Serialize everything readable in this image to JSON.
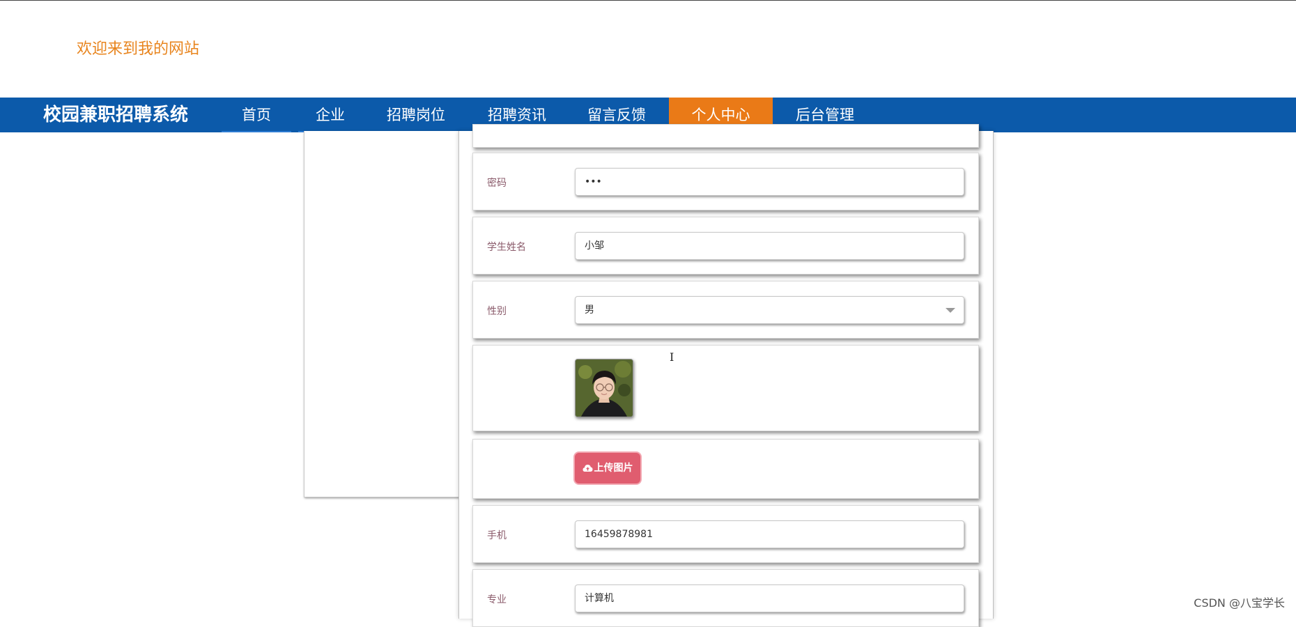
{
  "header": {
    "welcome": "欢迎来到我的网站"
  },
  "nav": {
    "brand": "校园兼职招聘系统",
    "items": [
      {
        "label": "首页"
      },
      {
        "label": "企业"
      },
      {
        "label": "招聘岗位"
      },
      {
        "label": "招聘资讯"
      },
      {
        "label": "留言反馈"
      },
      {
        "label": "个人中心"
      },
      {
        "label": "后台管理"
      }
    ],
    "active_item": "个人中心"
  },
  "form": {
    "password": {
      "label": "密码",
      "value": "•••"
    },
    "student_name": {
      "label": "学生姓名",
      "value": "小邹"
    },
    "gender": {
      "label": "性别",
      "value": "男"
    },
    "photo": {
      "icon": "avatar-photo"
    },
    "upload": {
      "label": "上传图片",
      "icon": "cloud-upload-icon"
    },
    "phone": {
      "label": "手机",
      "value": "16459878981"
    },
    "major": {
      "label": "专业",
      "value": "计算机"
    }
  },
  "watermark": "CSDN @八宝学长",
  "colors": {
    "nav_bg": "#0c5aaa",
    "nav_active": "#ea7a17",
    "welcome_text": "#e8841d",
    "upload_button": "#e05d6f"
  }
}
